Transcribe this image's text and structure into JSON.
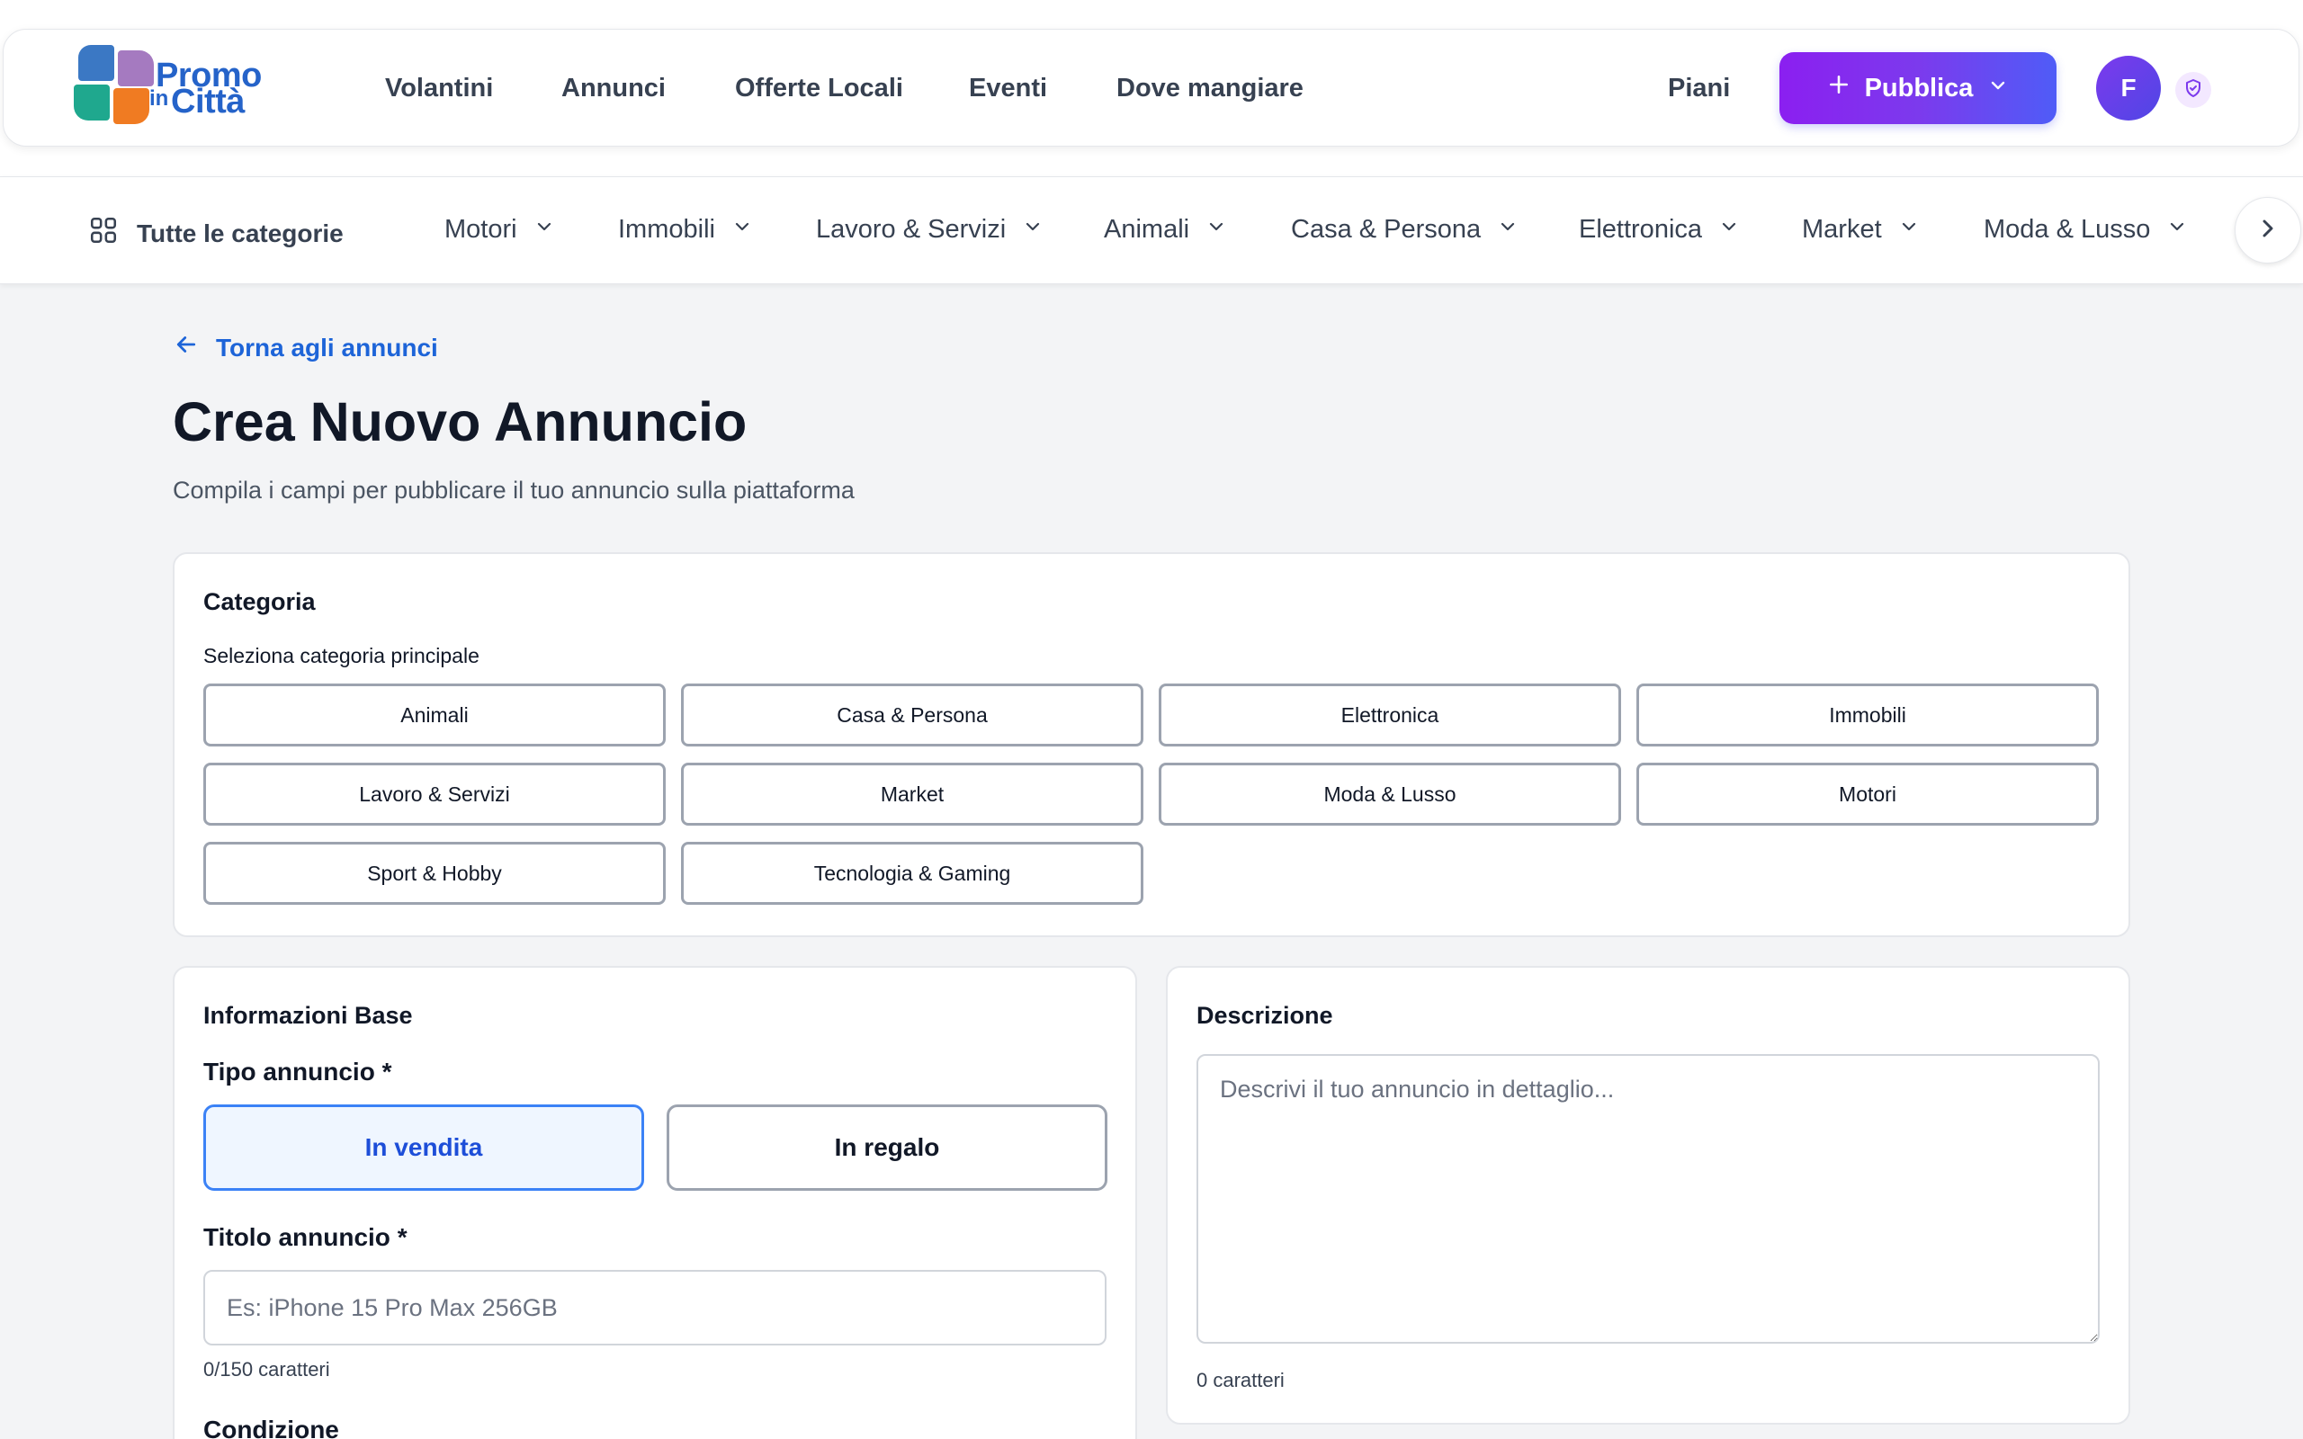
{
  "brand": {
    "logo_line1": "Promo",
    "logo_in": "in",
    "logo_line2": "Città",
    "tile_colors": [
      "#3b78c4",
      "#a57ac0",
      "#1fa88e",
      "#f07b22"
    ]
  },
  "header": {
    "nav": [
      "Volantini",
      "Annunci",
      "Offerte Locali",
      "Eventi",
      "Dove mangiare"
    ],
    "plans_label": "Piani",
    "publish_label": "Pubblica",
    "avatar_initial": "F",
    "accent_color": "#7c3aed"
  },
  "category_bar": {
    "all_label": "Tutte le categorie",
    "items": [
      "Motori",
      "Immobili",
      "Lavoro & Servizi",
      "Animali",
      "Casa & Persona",
      "Elettronica",
      "Market",
      "Moda & Lusso"
    ]
  },
  "page": {
    "back_label": "Torna agli annunci",
    "title": "Crea Nuovo Annuncio",
    "subtitle": "Compila i campi per pubblicare il tuo annuncio sulla piattaforma"
  },
  "category_card": {
    "title": "Categoria",
    "select_label": "Seleziona categoria principale",
    "options": [
      "Animali",
      "Casa & Persona",
      "Elettronica",
      "Immobili",
      "Lavoro & Servizi",
      "Market",
      "Moda & Lusso",
      "Motori",
      "Sport & Hobby",
      "Tecnologia & Gaming"
    ]
  },
  "basic_info": {
    "title": "Informazioni Base",
    "type_label": "Tipo annuncio *",
    "type_options": [
      "In vendita",
      "In regalo"
    ],
    "type_selected": "In vendita",
    "title_label": "Titolo annuncio *",
    "title_placeholder": "Es: iPhone 15 Pro Max 256GB",
    "title_value": "",
    "title_counter": "0/150 caratteri",
    "condition_label": "Condizione"
  },
  "description": {
    "title": "Descrizione",
    "placeholder": "Descrivi il tuo annuncio in dettaglio...",
    "value": "",
    "counter": "0 caratteri"
  }
}
